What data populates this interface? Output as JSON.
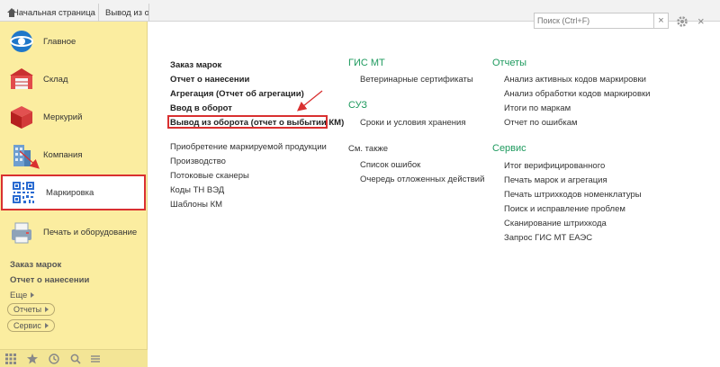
{
  "tabs": {
    "home": "Начальная страница",
    "second": "Вывод из о"
  },
  "sidebar": {
    "sections": [
      {
        "label": "Главное"
      },
      {
        "label": "Склад"
      },
      {
        "label": "Меркурий"
      },
      {
        "label": "Компания"
      },
      {
        "label": "Маркировка"
      },
      {
        "label": "Печать и оборудование"
      }
    ],
    "links": [
      "Заказ марок",
      "Отчет о нанесении"
    ],
    "more": "Еще",
    "pills": [
      "Отчеты",
      "Сервис"
    ]
  },
  "search": {
    "placeholder": "Поиск (Ctrl+F)",
    "clear": "×"
  },
  "toolbar": {
    "close": "×"
  },
  "col1": {
    "bold_items": [
      "Заказ марок",
      "Отчет о нанесении",
      "Агрегация (Отчет об агрегации)",
      "Ввод в оборот",
      "Вывод из оборота (отчет о выбытии КМ)"
    ],
    "items": [
      "Приобретение маркируемой продукции",
      "Производство",
      "Потоковые сканеры",
      "Коды ТН ВЭД",
      "Шаблоны КМ"
    ]
  },
  "col2": {
    "heading1": "ГИС МТ",
    "items1": [
      "Ветеринарные сертификаты"
    ],
    "heading2": "СУЗ",
    "items2": [
      "Сроки и условия хранения"
    ],
    "subheading": "См. также",
    "items3": [
      "Список ошибок",
      "Очередь отложенных действий"
    ]
  },
  "col3": {
    "heading1": "Отчеты",
    "items1": [
      "Анализ активных кодов маркировки",
      "Анализ обработки кодов маркировки",
      "Итоги по маркам",
      "Отчет по ошибкам"
    ],
    "heading2": "Сервис",
    "items2": [
      "Итог верифицированного",
      "Печать марок и агрегация",
      "Печать штрихкодов номенклатуры",
      "Поиск и исправление проблем",
      "Сканирование штрихкода",
      "Запрос ГИС МТ ЕАЭС"
    ]
  },
  "colors": {
    "sidebar_bg": "#fbeda0",
    "accent_green": "#1e9a5e",
    "highlight_red": "#d93030"
  }
}
